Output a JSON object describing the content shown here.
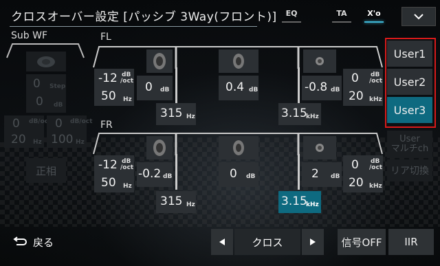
{
  "header": {
    "title": "クロスオーバー設定 [パッシブ 3Way(フロント)]",
    "tabs": [
      {
        "label": "EQ",
        "active": false
      },
      {
        "label": "TA",
        "active": false
      },
      {
        "label": "X'o",
        "active": true
      }
    ],
    "menu_icon": "chevron-down-icon"
  },
  "subwf": {
    "label": "Sub WF",
    "step_value": "0",
    "step_label": "Step",
    "level_value": "0",
    "level_unit": "dB",
    "slope_left": "0",
    "slope_right": "0",
    "slope_unit": "dB/oct",
    "freq_left": "20",
    "freq_left_unit": "Hz",
    "freq_right": "100",
    "freq_right_unit": "Hz",
    "phase_label": "正相"
  },
  "fl": {
    "label": "FL",
    "hp_slope": "-12",
    "hp_slope_unit_top": "dB",
    "hp_slope_unit_bottom": "/oct",
    "hp_freq": "50",
    "hp_freq_unit": "Hz",
    "woofer_level": "0",
    "mid_level": "0.4",
    "tweeter_level": "-0.8",
    "level_unit": "dB",
    "lp_slope": "0",
    "lp_slope_unit_top": "dB",
    "lp_slope_unit_bottom": "/oct",
    "lp_freq": "20",
    "lp_freq_unit": "kHz",
    "cross_low": "315",
    "cross_low_unit": "Hz",
    "cross_high": "3.15",
    "cross_high_unit": "kHz"
  },
  "fr": {
    "label": "FR",
    "hp_slope": "-12",
    "hp_slope_unit_top": "dB",
    "hp_slope_unit_bottom": "/oct",
    "hp_freq": "50",
    "hp_freq_unit": "Hz",
    "woofer_level": "-0.2",
    "mid_level": "0",
    "tweeter_level": "2",
    "level_unit": "dB",
    "lp_slope": "0",
    "lp_slope_unit_top": "dB",
    "lp_slope_unit_bottom": "/oct",
    "lp_freq": "20",
    "lp_freq_unit": "kHz",
    "cross_low": "315",
    "cross_low_unit": "Hz",
    "cross_high": "3.15",
    "cross_high_unit": "kHz"
  },
  "users": [
    {
      "label": "User1",
      "active": false
    },
    {
      "label": "User2",
      "active": false
    },
    {
      "label": "User3",
      "active": true
    }
  ],
  "side": {
    "user_multich": "User\nマルチch",
    "rear_switch": "リア切換"
  },
  "footer": {
    "back_label": "戻る",
    "nav_label": "クロス",
    "signal_off": "信号OFF",
    "iir": "IIR"
  },
  "colors": {
    "accent": "#0e6a80",
    "highlight_border": "#d81a1a"
  }
}
